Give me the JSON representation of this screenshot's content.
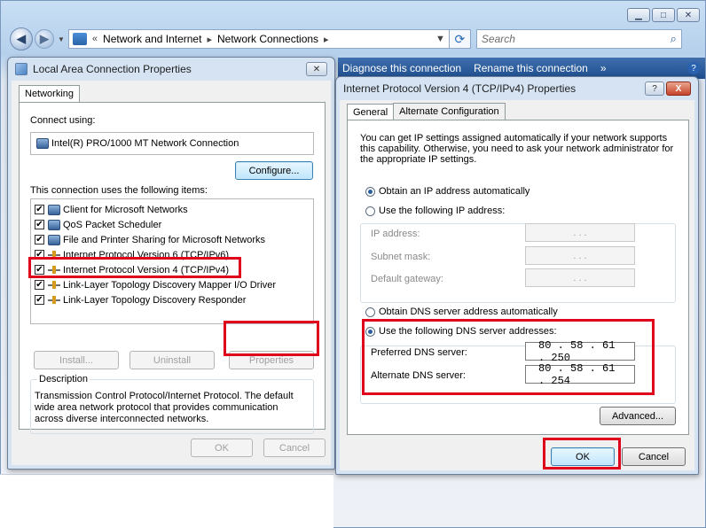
{
  "explorer": {
    "breadcrumb": [
      "Network and Internet",
      "Network Connections"
    ],
    "search_placeholder": "Search",
    "commands": [
      "Diagnose this connection",
      "Rename this connection",
      "»"
    ],
    "help": "?"
  },
  "lac_dialog": {
    "title": "Local Area Connection Properties",
    "tab": "Networking",
    "connect_using_label": "Connect using:",
    "adapter": "Intel(R) PRO/1000 MT Network Connection",
    "configure_button": "Configure...",
    "items_label": "This connection uses the following items:",
    "items": [
      {
        "label": "Client for Microsoft Networks",
        "checked": true,
        "icon": "network-client-icon"
      },
      {
        "label": "QoS Packet Scheduler",
        "checked": true,
        "icon": "network-service-icon"
      },
      {
        "label": "File and Printer Sharing for Microsoft Networks",
        "checked": true,
        "icon": "network-service-icon"
      },
      {
        "label": "Internet Protocol Version 6 (TCP/IPv6)",
        "checked": true,
        "icon": "protocol-icon"
      },
      {
        "label": "Internet Protocol Version 4 (TCP/IPv4)",
        "checked": true,
        "icon": "protocol-icon"
      },
      {
        "label": "Link-Layer Topology Discovery Mapper I/O Driver",
        "checked": true,
        "icon": "protocol-icon"
      },
      {
        "label": "Link-Layer Topology Discovery Responder",
        "checked": true,
        "icon": "protocol-icon"
      }
    ],
    "install_button": "Install...",
    "uninstall_button": "Uninstall",
    "properties_button": "Properties",
    "description_label": "Description",
    "description_text": "Transmission Control Protocol/Internet Protocol. The default wide area network protocol that provides communication across diverse interconnected networks.",
    "ok_button": "OK",
    "cancel_button": "Cancel"
  },
  "ipv4_dialog": {
    "title": "Internet Protocol Version 4 (TCP/IPv4) Properties",
    "help": "?",
    "close": "X",
    "tabs": [
      "General",
      "Alternate Configuration"
    ],
    "intro": "You can get IP settings assigned automatically if your network supports this capability. Otherwise, you need to ask your network administrator for the appropriate IP settings.",
    "ip_auto_label": "Obtain an IP address automatically",
    "ip_manual_label": "Use the following IP address:",
    "ip_address_label": "IP address:",
    "subnet_label": "Subnet mask:",
    "gateway_label": "Default gateway:",
    "dns_auto_label": "Obtain DNS server address automatically",
    "dns_manual_label": "Use the following DNS server addresses:",
    "preferred_dns_label": "Preferred DNS server:",
    "alternate_dns_label": "Alternate DNS server:",
    "preferred_dns": "80 . 58 . 61 . 250",
    "alternate_dns": "80 . 58 . 61 . 254",
    "advanced_button": "Advanced...",
    "ok_button": "OK",
    "cancel_button": "Cancel",
    "empty_ip": ". . ."
  },
  "colors": {
    "highlight_red": "#e0001b",
    "accent_blue": "#2a5ea3"
  }
}
